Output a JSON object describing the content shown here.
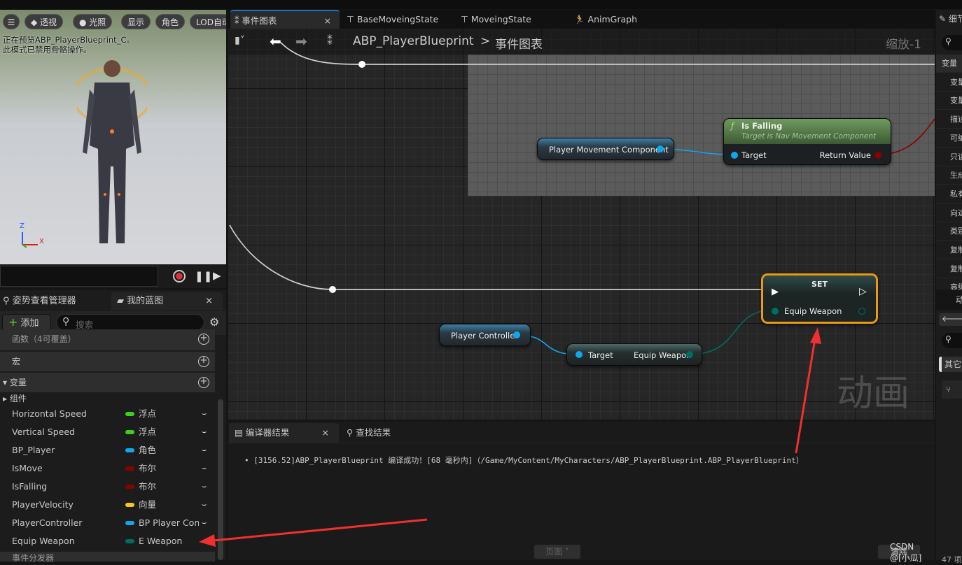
{
  "viewport": {
    "buttons": [
      "透视",
      "光照",
      "显示",
      "角色",
      "LOD自动"
    ],
    "info_line1": "正在预览ABP_PlayerBlueprint_C。",
    "info_line2": "此模式已禁用骨骼操作。",
    "axes": {
      "z": "Z",
      "x": "X"
    }
  },
  "left_panel": {
    "tabs": [
      {
        "label": "姿势查看管理器"
      },
      {
        "label": "我的蓝图"
      }
    ],
    "add_label": "添加",
    "search_placeholder": "搜索",
    "sections": {
      "functions": "函数（4可覆盖）",
      "macros": "宏",
      "variables": "变量",
      "components": "组件",
      "event_dispatchers": "事件分发器"
    },
    "variables": [
      {
        "name": "Horizontal Speed",
        "type": "浮点",
        "color": "#3fcf1a"
      },
      {
        "name": "Vertical Speed",
        "type": "浮点",
        "color": "#3fcf1a"
      },
      {
        "name": "BP_Player",
        "type": "角色",
        "color": "#10a6ee"
      },
      {
        "name": "IsMove",
        "type": "布尔",
        "color": "#8a0000"
      },
      {
        "name": "IsFalling",
        "type": "布尔",
        "color": "#8a0000"
      },
      {
        "name": "PlayerVelocity",
        "type": "向量",
        "color": "#f5c518"
      },
      {
        "name": "PlayerController",
        "type": "BP Player Controller",
        "color": "#10a6ee"
      },
      {
        "name": "Equip Weapon",
        "type": "E Weapon",
        "color": "#006d62"
      }
    ]
  },
  "graph": {
    "tabs": [
      {
        "label": "事件图表"
      },
      {
        "label": "BaseMoveingState"
      },
      {
        "label": "MoveingState"
      },
      {
        "label": "AnimGraph"
      }
    ],
    "breadcrumb": {
      "root": "ABP_PlayerBlueprint",
      "separator": ">",
      "current": "事件图表"
    },
    "zoom": "缩放-1",
    "watermark": "动画",
    "nodes": {
      "player_movement": "Player Movement Component",
      "is_falling": {
        "title": "Is Falling",
        "subtitle": "Target is Nav Movement Component",
        "in": "Target",
        "out": "Return Value"
      },
      "player_controller": "Player Controller",
      "getter": {
        "in": "Target",
        "out": "Equip Weapon"
      },
      "set": {
        "title": "SET",
        "pin": "Equip Weapon"
      }
    }
  },
  "bottom": {
    "tabs": [
      {
        "label": "编译器结果"
      },
      {
        "label": "查找结果"
      }
    ],
    "log": "[3156.52]ABP_PlayerBlueprint 编译成功！[68 毫秒内]（/Game/MyContent/MyCharacters/ABP_PlayerBlueprint.ABP_PlayerBlueprint）",
    "page_label": "页面",
    "clear_label": "清除",
    "credit": "CSDN @[小瓜]"
  },
  "right_panel": {
    "title": "细节",
    "rows": [
      "变量",
      "变量",
      "变量",
      "描述",
      "可编辑",
      "只读",
      "生成",
      "私有",
      "向这",
      "类别",
      "复制",
      "复制",
      "高级"
    ],
    "anim_title": "动画",
    "other": "其它",
    "count": "47 项"
  }
}
